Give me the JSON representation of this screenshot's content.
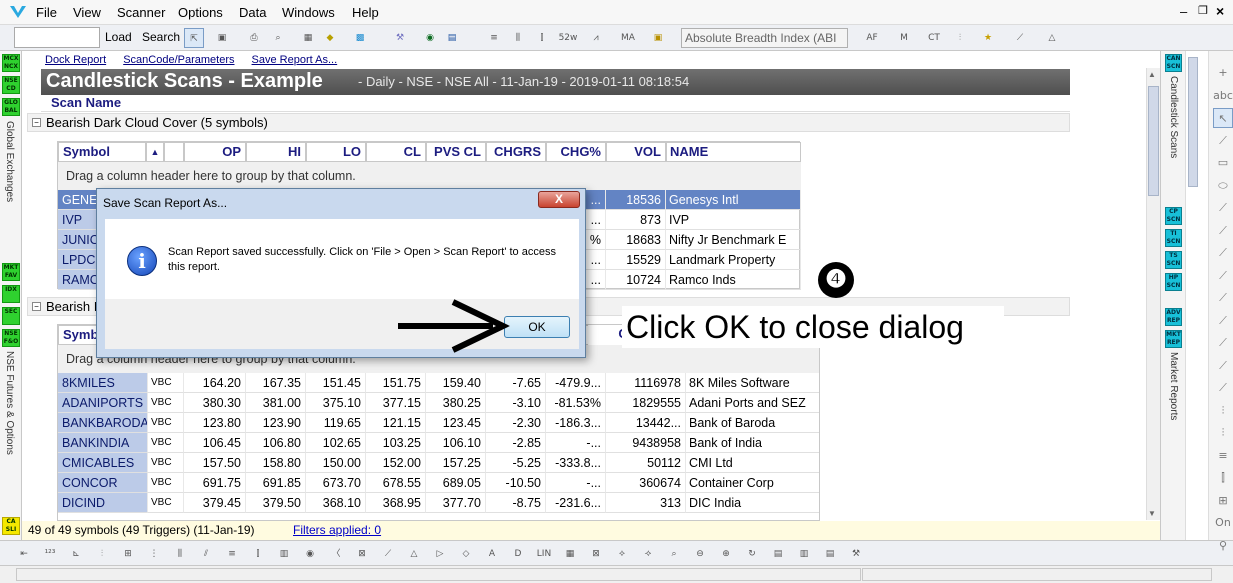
{
  "menu": [
    "File",
    "View",
    "Scanner",
    "Options",
    "Data",
    "Windows",
    "Help"
  ],
  "toolbar": {
    "load": "Load",
    "search": "Search",
    "indicator": "Absolute Breadth Index (ABI"
  },
  "left_panel": {
    "badges": [
      "MCX NCX",
      "NSE CD",
      "GLO BAL"
    ],
    "label1": "Global Exchanges",
    "badges2": [
      "MKT FAV",
      "IDX",
      "SEC",
      "NSE F&O"
    ],
    "label2": "NSE Futures & Options",
    "bottom_badge": "CA SLI"
  },
  "links": [
    "Dock Report",
    "ScanCode/Parameters",
    "Save Report As..."
  ],
  "report": {
    "title": "Candlestick Scans - Example",
    "subtitle": "- Daily - NSE - NSE All - 11-Jan-19 - 2019-01-11 08:18:54",
    "scan_name_header": "Scan Name"
  },
  "group1": {
    "label": "Bearish Dark Cloud Cover (5 symbols)",
    "headers": [
      "Symbol",
      "OP",
      "HI",
      "LO",
      "CL",
      "PVS CL",
      "CHGRS",
      "CHG%",
      "VOL",
      "NAME"
    ],
    "drag_hint": "Drag a column header here to group by that column.",
    "rows": [
      {
        "symbol": "GENE",
        "chg": "...",
        "vol": "18536",
        "name": "Genesys Intl"
      },
      {
        "symbol": "IVP",
        "chg": "...",
        "vol": "873",
        "name": "IVP"
      },
      {
        "symbol": "JUNIO",
        "chg": "%",
        "vol": "18683",
        "name": "Nifty Jr Benchmark E"
      },
      {
        "symbol": "LPDC",
        "chg": "...",
        "vol": "15529",
        "name": "Landmark Property"
      },
      {
        "symbol": "RAMC",
        "chg": "...",
        "vol": "10724",
        "name": "Ramco Inds"
      }
    ]
  },
  "group2": {
    "label": "Bearish I",
    "header_sym": "Symb",
    "header_chg": "G%",
    "drag_hint": "Drag a column header here to group by that column.",
    "rows": [
      {
        "symbol": "8KMILES",
        "vbc": "VBC",
        "op": "164.20",
        "hi": "167.35",
        "lo": "151.45",
        "cl": "151.75",
        "pvs": "159.40",
        "chgrs": "-7.65",
        "chgp": "-479.9...",
        "vol": "1116978",
        "name": "8K Miles Software"
      },
      {
        "symbol": "ADANIPORTS",
        "vbc": "VBC",
        "op": "380.30",
        "hi": "381.00",
        "lo": "375.10",
        "cl": "377.15",
        "pvs": "380.25",
        "chgrs": "-3.10",
        "chgp": "-81.53%",
        "vol": "1829555",
        "name": "Adani Ports and SEZ"
      },
      {
        "symbol": "BANKBARODA",
        "vbc": "VBC",
        "op": "123.80",
        "hi": "123.90",
        "lo": "119.65",
        "cl": "121.15",
        "pvs": "123.45",
        "chgrs": "-2.30",
        "chgp": "-186.3...",
        "vol": "13442...",
        "name": "Bank of Baroda"
      },
      {
        "symbol": "BANKINDIA",
        "vbc": "VBC",
        "op": "106.45",
        "hi": "106.80",
        "lo": "102.65",
        "cl": "103.25",
        "pvs": "106.10",
        "chgrs": "-2.85",
        "chgp": "-...",
        "vol": "9438958",
        "name": "Bank of India"
      },
      {
        "symbol": "CMICABLES",
        "vbc": "VBC",
        "op": "157.50",
        "hi": "158.80",
        "lo": "150.00",
        "cl": "152.00",
        "pvs": "157.25",
        "chgrs": "-5.25",
        "chgp": "-333.8...",
        "vol": "50112",
        "name": "CMI Ltd"
      },
      {
        "symbol": "CONCOR",
        "vbc": "VBC",
        "op": "691.75",
        "hi": "691.85",
        "lo": "673.70",
        "cl": "678.55",
        "pvs": "689.05",
        "chgrs": "-10.50",
        "chgp": "-...",
        "vol": "360674",
        "name": "Container Corp"
      },
      {
        "symbol": "DICIND",
        "vbc": "VBC",
        "op": "379.45",
        "hi": "379.50",
        "lo": "368.10",
        "cl": "368.95",
        "pvs": "377.70",
        "chgrs": "-8.75",
        "chgp": "-231.6...",
        "vol": "313",
        "name": "DIC India"
      }
    ]
  },
  "status": {
    "symbols": "49 of 49 symbols (49 Triggers) (11-Jan-19)",
    "filters": "Filters applied: 0"
  },
  "right_panel": {
    "badges": [
      "CAN SCN",
      "CP SCN",
      "TI SCN",
      "TS SCN",
      "HP SCN",
      "ADV REP",
      "MKT REP"
    ],
    "label1": "Candlestick Scans",
    "label2": "Market Reports"
  },
  "dialog": {
    "title": "Save Scan Report As...",
    "close": "X",
    "message": "Scan Report saved successfully. Click on 'File > Open > Scan Report' to access this report.",
    "ok": "OK",
    "info_glyph": "i"
  },
  "callout": {
    "number": "❹",
    "text": "Click OK to close dialog"
  }
}
